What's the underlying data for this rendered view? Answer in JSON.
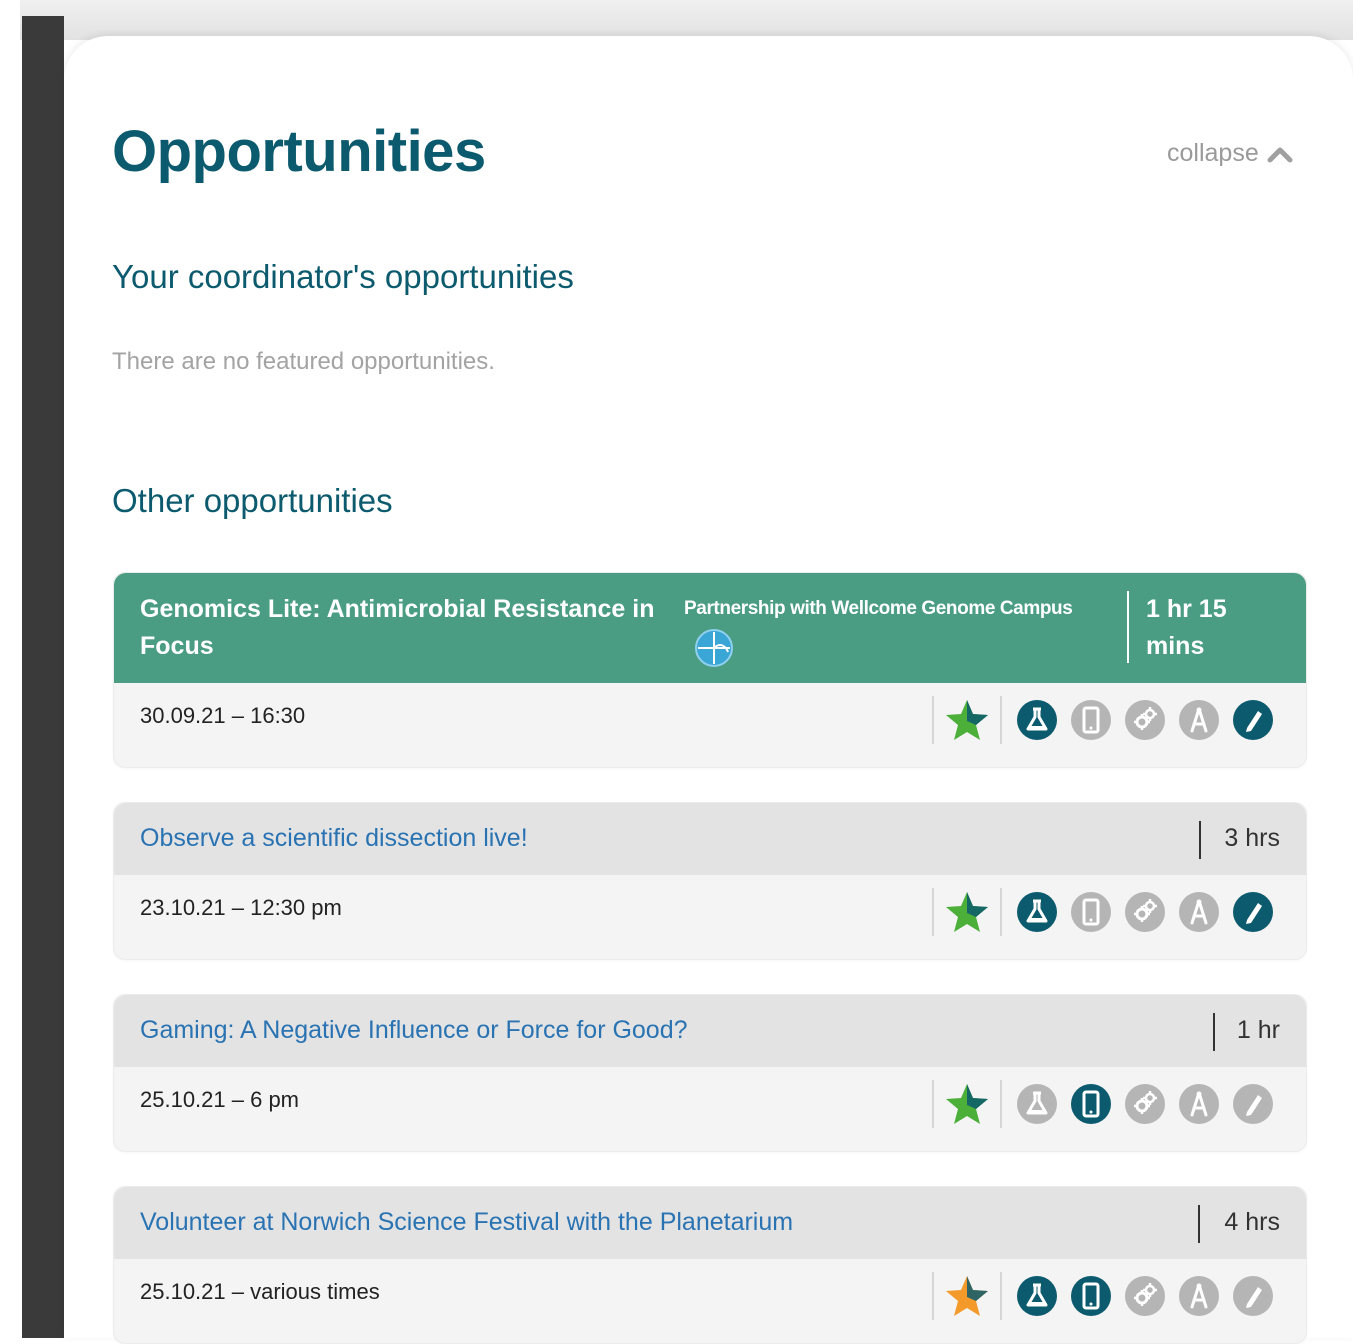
{
  "page": {
    "title": "Opportunities",
    "collapse_label": "collapse"
  },
  "sections": {
    "coordinator": {
      "title": "Your coordinator's opportunities",
      "empty_message": "There are no featured opportunities."
    },
    "other": {
      "title": "Other opportunities"
    }
  },
  "colors": {
    "brand_teal": "#0c5a6e",
    "featured_green": "#4a9d82",
    "link_blue": "#2a73b3",
    "star_green": "#4caf3a",
    "star_orange": "#f39a2b",
    "icon_active": "#0c5a6e",
    "icon_inactive": "#b5b5b5"
  },
  "category_icons": [
    "flask-icon",
    "tablet-icon",
    "gears-icon",
    "compass-icon",
    "pen-icon"
  ],
  "opportunities": [
    {
      "title": "Genomics Lite: Antimicrobial Resistance in Focus",
      "partner": "Partnership with Wellcome Genome Campus",
      "duration": "1 hr 15 mins",
      "date": "30.09.21 – 16:30",
      "featured": true,
      "star": "green",
      "active": [
        true,
        false,
        false,
        false,
        true
      ]
    },
    {
      "title": "Observe a scientific dissection live!",
      "duration": "3 hrs",
      "date": "23.10.21 – 12:30 pm",
      "featured": false,
      "star": "green",
      "active": [
        true,
        false,
        false,
        false,
        true
      ]
    },
    {
      "title": "Gaming: A Negative Influence or Force for Good?",
      "duration": "1 hr",
      "date": "25.10.21 – 6 pm",
      "featured": false,
      "star": "green",
      "active": [
        false,
        true,
        false,
        false,
        false
      ]
    },
    {
      "title": "Volunteer at Norwich Science Festival with the Planetarium",
      "duration": "4 hrs",
      "date": "25.10.21 – various times",
      "featured": false,
      "star": "orange",
      "active": [
        true,
        true,
        false,
        false,
        false
      ]
    }
  ]
}
